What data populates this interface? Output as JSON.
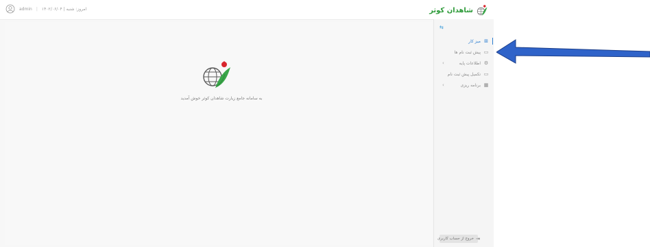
{
  "header": {
    "brand": "شاهدان کوثر",
    "date_text": "امروز: شنبه | ۱۴۰۲/۰۶/۰۴",
    "username": "admin",
    "user_icon": "user-circle-icon"
  },
  "sidebar": {
    "items": [
      {
        "label": "میز کار",
        "icon": "dashboard-icon",
        "active": true
      },
      {
        "label": "پیش ثبت نام ها",
        "icon": "document-icon"
      },
      {
        "label": "اطلاعات پایه",
        "icon": "settings-icon",
        "has_children": true
      },
      {
        "label": "تکمیل پیش ثبت نام",
        "icon": "document-icon"
      },
      {
        "label": "برنامه ریزی",
        "icon": "calendar-icon",
        "has_children": true
      }
    ],
    "logout_label": "خروج از حساب کاربری"
  },
  "main": {
    "welcome_text": "به سامانه جامع زیارت شاهدان کوثر خوش آمدید"
  },
  "colors": {
    "brand": "#2e9b3a",
    "accent": "#2e7fd1",
    "arrow_fill": "#2f63c9"
  }
}
